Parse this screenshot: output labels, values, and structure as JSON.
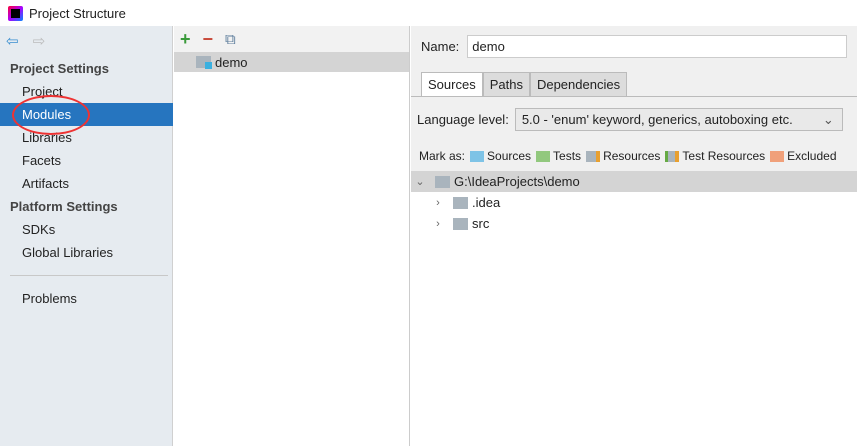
{
  "window": {
    "title": "Project Structure"
  },
  "sidebar": {
    "project_settings_header": "Project Settings",
    "project_items": [
      "Project",
      "Modules",
      "Libraries",
      "Facets",
      "Artifacts"
    ],
    "platform_settings_header": "Platform Settings",
    "platform_items": [
      "SDKs",
      "Global Libraries"
    ],
    "problems": "Problems",
    "selected": "Modules"
  },
  "modules": {
    "toolbar": {
      "add": "+",
      "remove": "−"
    },
    "items": [
      "demo"
    ]
  },
  "details": {
    "name_label": "Name:",
    "name_value": "demo",
    "tabs": [
      "Sources",
      "Paths",
      "Dependencies"
    ],
    "language_label": "Language level:",
    "language_value": "5.0 - 'enum' keyword, generics, autoboxing etc.",
    "mark_as_label": "Mark as:",
    "mark_as": [
      {
        "label": "Sources",
        "color": "#7ec3e6"
      },
      {
        "label": "Tests",
        "color": "#92c87e"
      },
      {
        "label": "Resources",
        "color": "#a9b4bd"
      },
      {
        "label": "Test Resources",
        "color": "#a9b4bd"
      },
      {
        "label": "Excluded",
        "color": "#f0a07a"
      }
    ],
    "tree": {
      "root": "G:\\IdeaProjects\\demo",
      "children": [
        ".idea",
        "src"
      ]
    }
  }
}
